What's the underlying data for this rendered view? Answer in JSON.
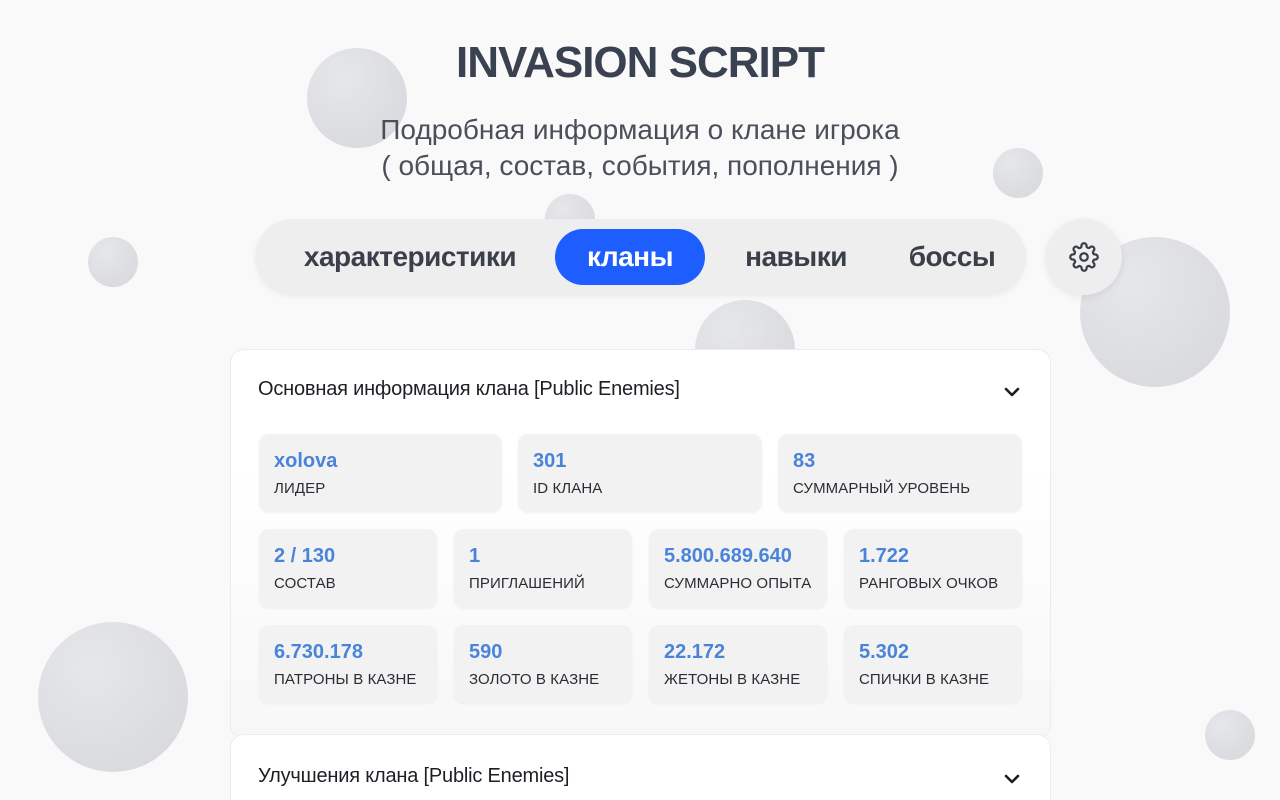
{
  "header": {
    "title": "INVASION SCRIPT",
    "subtitle_line1": "Подробная информация о клане игрока",
    "subtitle_line2": "( общая, состав, события, пополнения )"
  },
  "tabs": [
    {
      "label": "характеристики",
      "active": false
    },
    {
      "label": "кланы",
      "active": true
    },
    {
      "label": "навыки",
      "active": false
    },
    {
      "label": "боссы",
      "active": false
    }
  ],
  "settings_icon": "gear-icon",
  "accent_color": "#1f5efe",
  "value_color": "#4a84d9",
  "clan_info": {
    "heading": "Основная информация клана [Public Enemies]",
    "expand_icon": "chevron-down-icon",
    "stats": [
      {
        "value": "xolova",
        "label": "ЛИДЕР"
      },
      {
        "value": "301",
        "label": "ID КЛАНА"
      },
      {
        "value": "83",
        "label": "СУММАРНЫЙ УРОВЕНЬ"
      },
      {
        "value": "2 / 130",
        "label": "СОСТАВ"
      },
      {
        "value": "1",
        "label": "ПРИГЛАШЕНИЙ"
      },
      {
        "value": "5.800.689.640",
        "label": "СУММАРНО ОПЫТА"
      },
      {
        "value": "1.722",
        "label": "РАНГОВЫХ ОЧКОВ"
      },
      {
        "value": "6.730.178",
        "label": "ПАТРОНЫ В КАЗНЕ"
      },
      {
        "value": "590",
        "label": "ЗОЛОТО В КАЗНЕ"
      },
      {
        "value": "22.172",
        "label": "ЖЕТОНЫ В КАЗНЕ"
      },
      {
        "value": "5.302",
        "label": "СПИЧКИ В КАЗНЕ"
      }
    ]
  },
  "clan_upgrades": {
    "heading": "Улучшения клана [Public Enemies]",
    "expand_icon": "chevron-down-icon"
  }
}
